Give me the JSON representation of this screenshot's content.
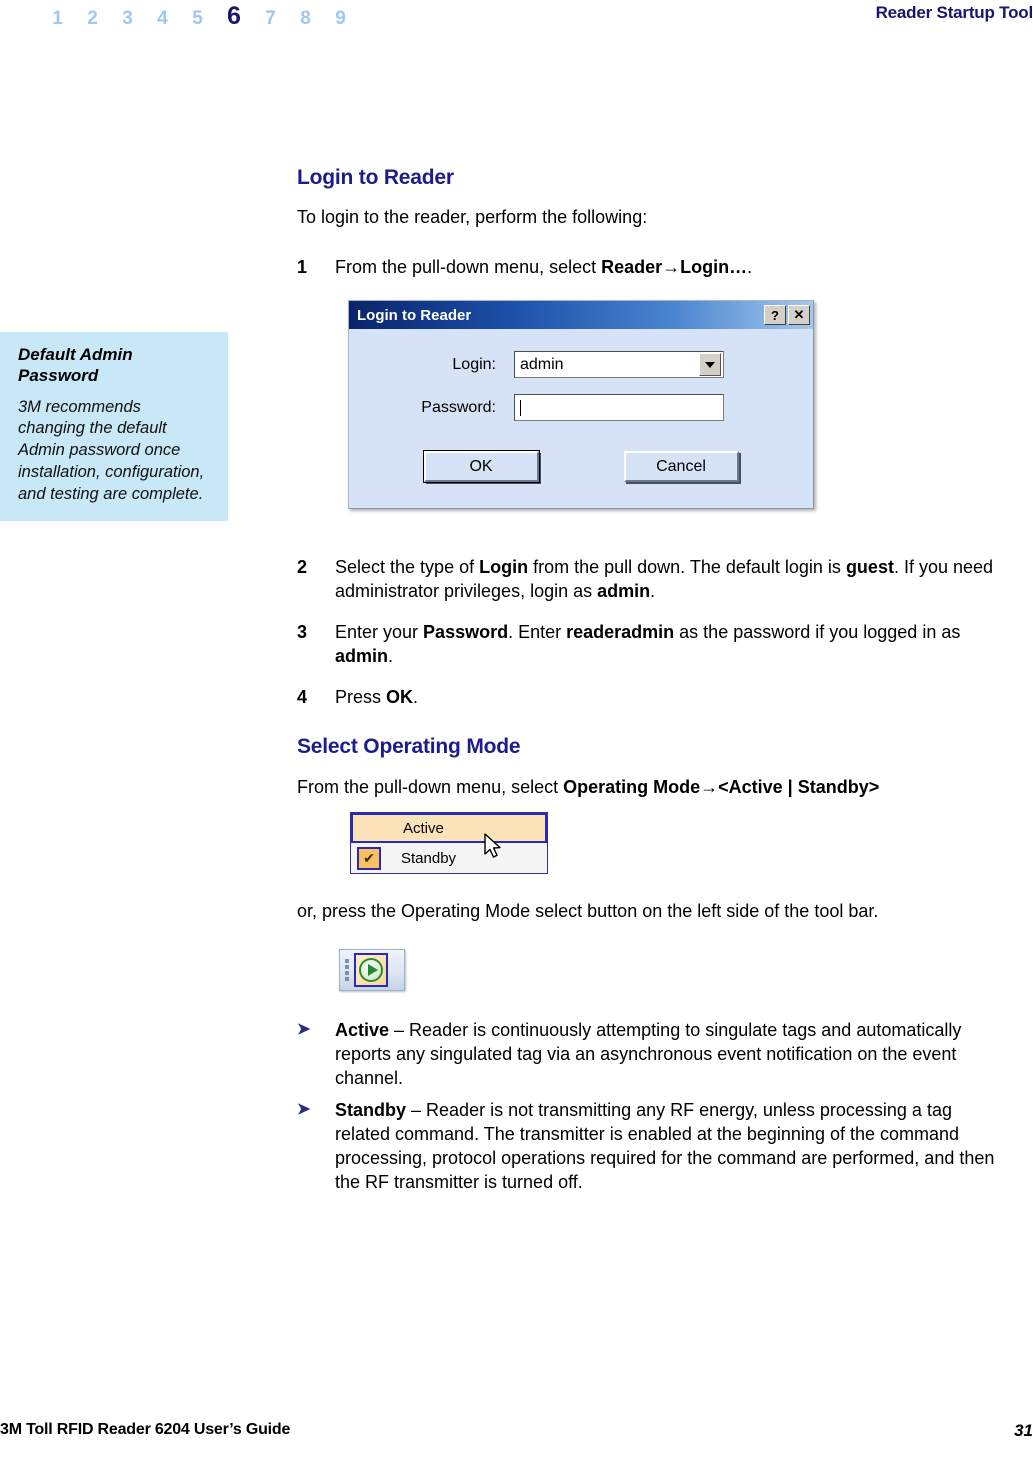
{
  "header": {
    "chapter_numbers": [
      "1",
      "2",
      "3",
      "4",
      "5",
      "6",
      "7",
      "8",
      "9"
    ],
    "active_chapter": "6",
    "title": "Reader Startup Tool",
    "inactive_color": "#9dc8f2",
    "active_color": "#17176b",
    "title_color": "#16166e"
  },
  "note": {
    "title": "Default Admin Password",
    "body": "3M recommends changing the default Admin password once installation, configuration, and testing are complete.",
    "background": "#c8e8f8"
  },
  "sections": {
    "login": {
      "heading": "Login to Reader",
      "intro": "To login to the reader, perform the following:",
      "steps": [
        {
          "num": "1",
          "parts": [
            {
              "text": "From the pull-down menu, select ",
              "bold": false
            },
            {
              "text": "Reader→Login…",
              "bold": true
            },
            {
              "text": ".",
              "bold": false
            }
          ]
        },
        {
          "num": "2",
          "parts": [
            {
              "text": "Select the type of ",
              "bold": false
            },
            {
              "text": "Login",
              "bold": true
            },
            {
              "text": " from the pull down. The default login is ",
              "bold": false
            },
            {
              "text": "guest",
              "bold": true
            },
            {
              "text": ". If you need administrator privileges, login as ",
              "bold": false
            },
            {
              "text": "admin",
              "bold": true
            },
            {
              "text": ".",
              "bold": false
            }
          ]
        },
        {
          "num": "3",
          "parts": [
            {
              "text": "Enter your ",
              "bold": false
            },
            {
              "text": "Password",
              "bold": true
            },
            {
              "text": ". Enter ",
              "bold": false
            },
            {
              "text": "readeradmin",
              "bold": true
            },
            {
              "text": " as the password if you logged in as ",
              "bold": false
            },
            {
              "text": "admin",
              "bold": true
            },
            {
              "text": ".",
              "bold": false
            }
          ]
        },
        {
          "num": "4",
          "parts": [
            {
              "text": "Press ",
              "bold": false
            },
            {
              "text": "OK",
              "bold": true
            },
            {
              "text": ".",
              "bold": false
            }
          ]
        }
      ]
    },
    "operating_mode": {
      "heading": "Select Operating Mode",
      "intro_parts": [
        {
          "text": "From the pull-down menu, select ",
          "bold": false
        },
        {
          "text": "Operating Mode→<Active | Standby>",
          "bold": true
        }
      ],
      "alt_instruction": "or, press the Operating Mode select button on the left side of the tool bar.",
      "bullets": [
        {
          "term": "Active",
          "dash": " – ",
          "description": "Reader is continuously attempting to singulate tags and automatically reports any singulated tag via an asynchronous event notification on the event channel."
        },
        {
          "term": "Standby",
          "dash": " – ",
          "description": "Reader is not transmitting any RF energy, unless processing a tag related command. The transmitter is enabled at the beginning of the command processing, protocol operations required for the command are performed, and then the RF transmitter is turned off."
        }
      ],
      "bullet_marker": "➤"
    }
  },
  "login_dialog": {
    "title": "Login to Reader",
    "help_button": "?",
    "close_button": "✕",
    "login_label": "Login:",
    "login_value": "admin",
    "password_label": "Password:",
    "password_value": "",
    "ok_label": "OK",
    "cancel_label": "Cancel",
    "titlebar_start_color": "#0a246a",
    "titlebar_end_color": "#a6c8ec",
    "face_color": "#d6e2f5"
  },
  "mode_menu": {
    "items": [
      {
        "label": "Active",
        "checked": false,
        "highlighted": true
      },
      {
        "label": "Standby",
        "checked": true,
        "highlighted": false
      }
    ],
    "check_glyph": "✔",
    "highlight_color": "#fce3ba",
    "border_color": "#2f2fa0",
    "check_box_color": "#f8bf63"
  },
  "toolbar_figure": {
    "button_name": "Operating Mode select button",
    "icon": "play-circle-icon",
    "icon_color": "#1f8a2f",
    "button_face_color": "#fde0ad"
  },
  "footer": {
    "left": "3M Toll RFID Reader 6204 User’s Guide",
    "page_number": "31"
  }
}
